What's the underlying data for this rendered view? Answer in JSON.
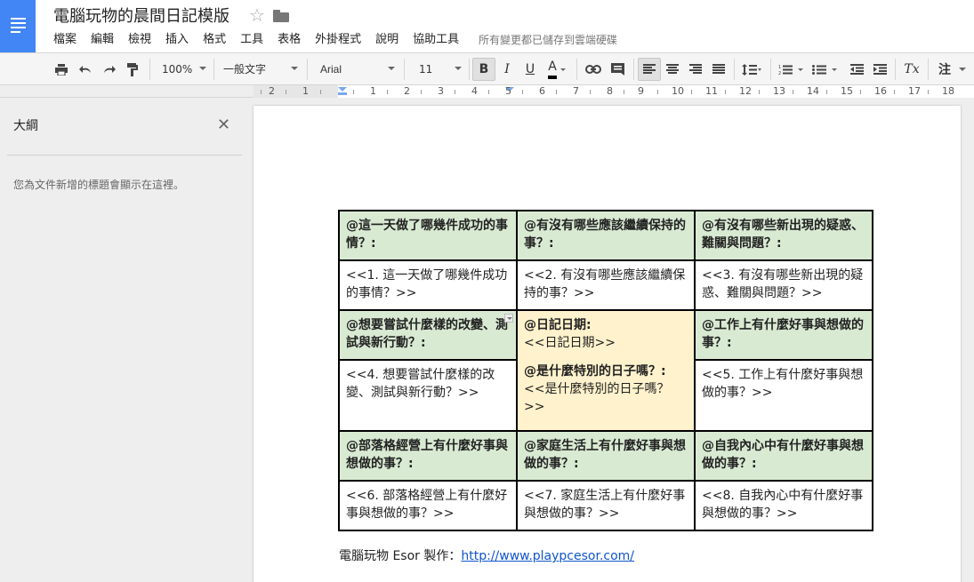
{
  "app": {
    "doc_title": "電腦玩物的晨間日記模版",
    "save_status": "所有變更都已儲存到雲端硬碟",
    "accent_color": "#4285f4"
  },
  "menus": [
    "檔案",
    "編輯",
    "檢視",
    "插入",
    "格式",
    "工具",
    "表格",
    "外掛程式",
    "說明",
    "協助工具"
  ],
  "toolbar": {
    "zoom": "100%",
    "style": "一般文字",
    "font": "Arial",
    "font_size": "11",
    "bold": "B",
    "italic": "I",
    "underline": "U",
    "text_color": "A",
    "clear_format": "Tx",
    "comment": "注"
  },
  "ruler": {
    "labels": [
      "2",
      "1",
      "1",
      "2",
      "3",
      "4",
      "5",
      "6",
      "7",
      "8",
      "9",
      "10",
      "11",
      "12",
      "13",
      "14",
      "15",
      "16",
      "17",
      "18"
    ]
  },
  "outline": {
    "title": "大綱",
    "hint": "您為文件新增的標題會顯示在這裡。"
  },
  "table": {
    "row1_headers": [
      "@這一天做了哪幾件成功的事情？:",
      "@有沒有哪些應該繼續保持的事？:",
      "@有沒有哪些新出現的疑惑、難關與問題？:"
    ],
    "row1_bodies": [
      "<<1. 這一天做了哪幾件成功的事情？>>",
      "<<2. 有沒有哪些應該繼續保持的事？>>",
      "<<3. 有沒有哪些新出現的疑惑、難關與問題？>>"
    ],
    "mid_left_header": "@想要嘗試什麼樣的改變、測試與新行動？:",
    "mid_left_body": "<<4. 想要嘗試什麼樣的改變、測試與新行動？>>",
    "center": {
      "date_label": "@日記日期:",
      "date_value": "<<日記日期>>",
      "special_label": "@是什麼特別的日子嗎？:",
      "special_value": "<<是什麼特別的日子嗎？>>"
    },
    "mid_right_header": "@工作上有什麼好事與想做的事？:",
    "mid_right_body": "<<5. 工作上有什麼好事與想做的事？>>",
    "row3_headers": [
      "@部落格經營上有什麼好事與想做的事？:",
      "@家庭生活上有什麼好事與想做的事？:",
      "@自我內心中有什麼好事與想做的事？:"
    ],
    "row3_bodies": [
      "<<6. 部落格經營上有什麼好事與想做的事？>>",
      "<<7. 家庭生活上有什麼好事與想做的事？>>",
      "<<8. 自我內心中有什麼好事與想做的事？>>"
    ],
    "header_bg": "#d9ead3",
    "center_bg": "#fff2cc"
  },
  "credit": {
    "prefix": "電腦玩物 Esor 製作：",
    "link": "http://www.playpcesor.com/"
  }
}
